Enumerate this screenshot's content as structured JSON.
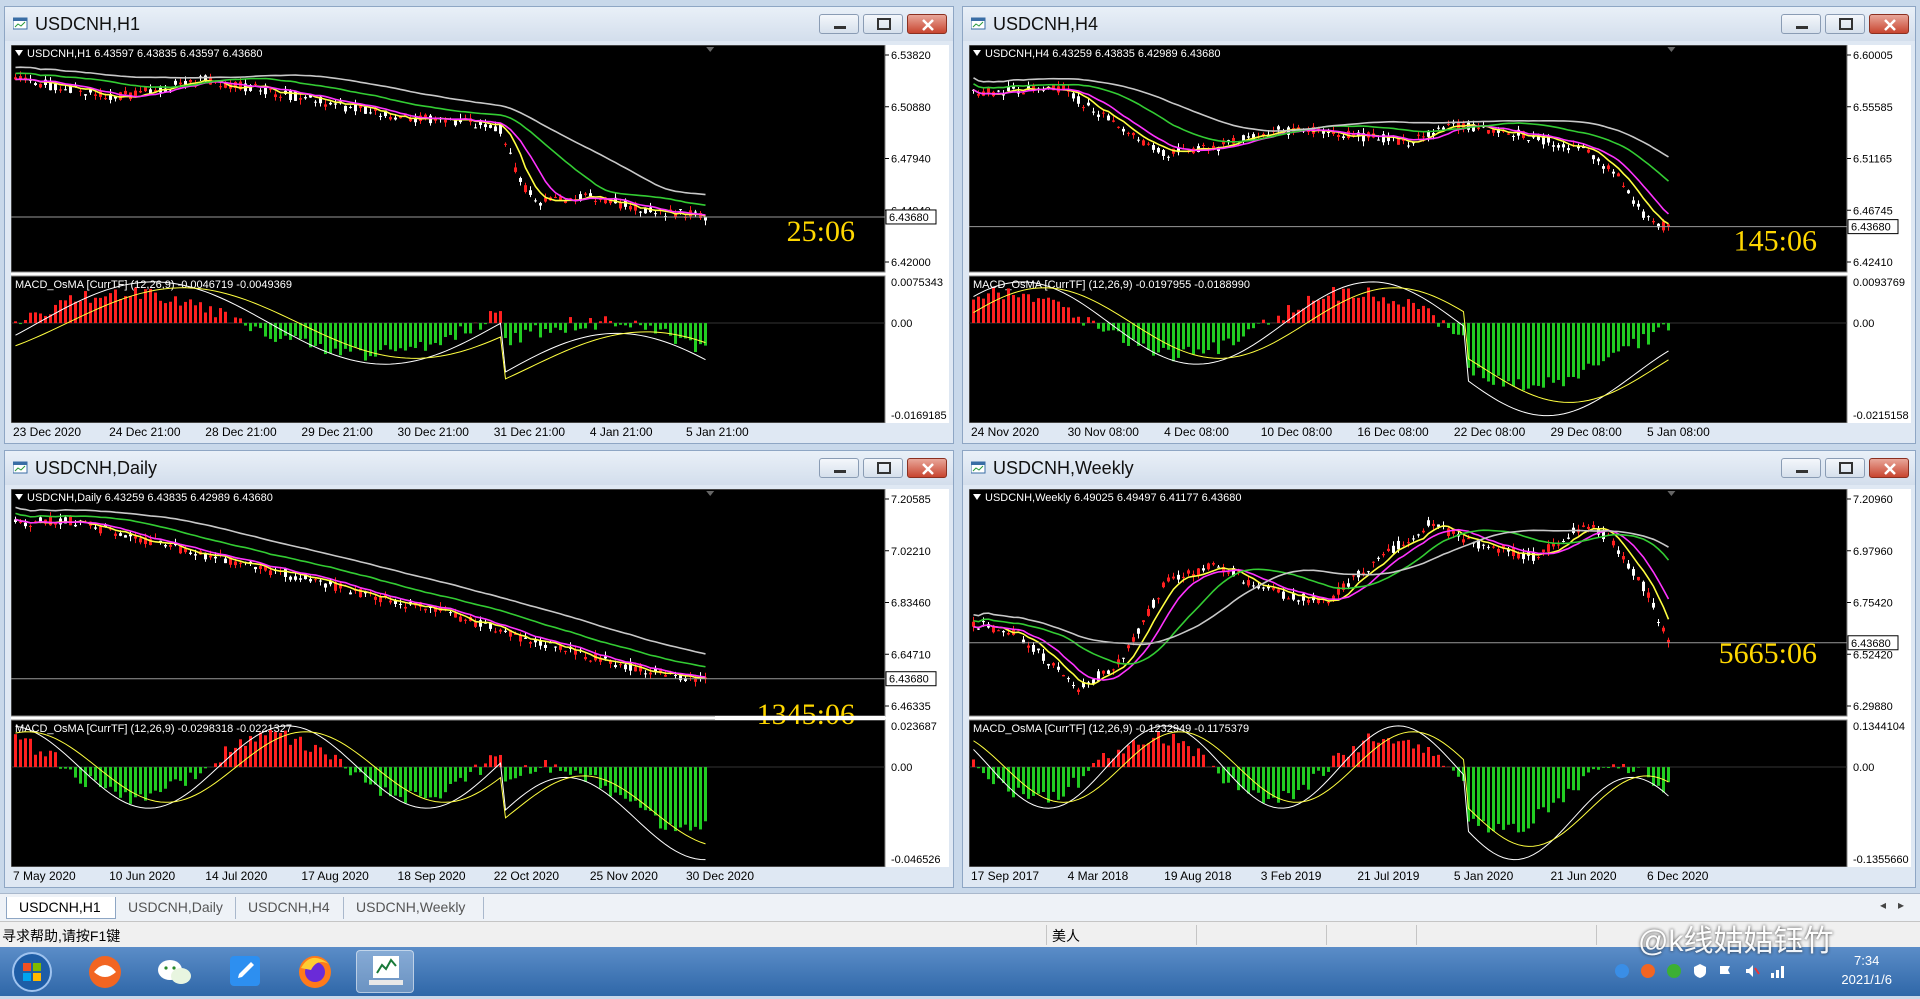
{
  "colors": {
    "bull": "#ffffff",
    "bear": "#ff2020",
    "ma_fast": "#ffff40",
    "ma_med": "#ff33ff",
    "ma_slow": "#33cc33",
    "ma_long": "#c8c8c8",
    "hist_pos": "#ff2020",
    "hist_neg": "#22cc22",
    "countdown": "#ffd700"
  },
  "windows": [
    {
      "title": "USDCNH,H1",
      "ohlc": "USDCNH,H1  6.43597 6.43835 6.43597 6.43680",
      "prices": [
        "6.53820",
        "6.50880",
        "6.47940",
        "6.44940",
        "6.42000"
      ],
      "current_price": "6.43680",
      "countdown": "25:06",
      "macd": "MACD_OsMA [CurrTF] (12,26,9) -0.0046719 -0.0049369",
      "macd_levels": [
        "0.0075343",
        "0.00",
        "-0.0169185"
      ],
      "dates": [
        "23 Dec 2020",
        "24 Dec 21:00",
        "28 Dec 21:00",
        "29 Dec 21:00",
        "30 Dec 21:00",
        "31 Dec 21:00",
        "4 Jan 21:00",
        "5 Jan 21:00"
      ]
    },
    {
      "title": "USDCNH,H4",
      "ohlc": "USDCNH,H4  6.43259 6.43835 6.42989 6.43680",
      "prices": [
        "6.60005",
        "6.55585",
        "6.51165",
        "6.46745",
        "6.42410"
      ],
      "current_price": "6.43680",
      "countdown": "145:06",
      "macd": "MACD_OsMA [CurrTF] (12,26,9) -0.0197955 -0.0188990",
      "macd_levels": [
        "0.0093769",
        "0.00",
        "-0.0215158"
      ],
      "dates": [
        "24 Nov 2020",
        "30 Nov 08:00",
        "4 Dec 08:00",
        "10 Dec 08:00",
        "16 Dec 08:00",
        "22 Dec 08:00",
        "29 Dec 08:00",
        "5 Jan 08:00"
      ]
    },
    {
      "title": "USDCNH,Daily",
      "ohlc": "USDCNH,Daily  6.43259 6.43835 6.42989 6.43680",
      "prices": [
        "7.20585",
        "7.02210",
        "6.83460",
        "6.64710",
        "6.46335"
      ],
      "current_price": "6.43680",
      "countdown": "1345:06",
      "macd": "MACD_OsMA [CurrTF] (12,26,9) -0.0298318 -0.0221327",
      "macd_levels": [
        "0.023687",
        "0.00",
        "-0.046526"
      ],
      "dates": [
        "7 May 2020",
        "10 Jun 2020",
        "14 Jul 2020",
        "17 Aug 2020",
        "18 Sep 2020",
        "22 Oct 2020",
        "25 Nov 2020",
        "30 Dec 2020"
      ]
    },
    {
      "title": "USDCNH,Weekly",
      "ohlc": "USDCNH,Weekly  6.49025 6.49497 6.41177 6.43680",
      "prices": [
        "7.20960",
        "6.97960",
        "6.75420",
        "6.52420",
        "6.29880"
      ],
      "current_price": "6.43680",
      "countdown": "5665:06",
      "macd": "MACD_OsMA [CurrTF] (12,26,9) -0.1232949 -0.1175379",
      "macd_levels": [
        "0.1344104",
        "0.00",
        "-0.1355660"
      ],
      "dates": [
        "17 Sep 2017",
        "4 Mar 2018",
        "19 Aug 2018",
        "3 Feb 2019",
        "21 Jul 2019",
        "5 Jan 2020",
        "21 Jun 2020",
        "6 Dec 2020"
      ]
    }
  ],
  "tabs": [
    "USDCNH,H1",
    "USDCNH,Daily",
    "USDCNH,H4",
    "USDCNH,Weekly"
  ],
  "status": {
    "help": "寻求帮助,请按F1键",
    "profile": "美人"
  },
  "clock": {
    "time": "7:34",
    "date": "2021/1/6"
  },
  "watermark": "@k线姑姑钰竹"
}
